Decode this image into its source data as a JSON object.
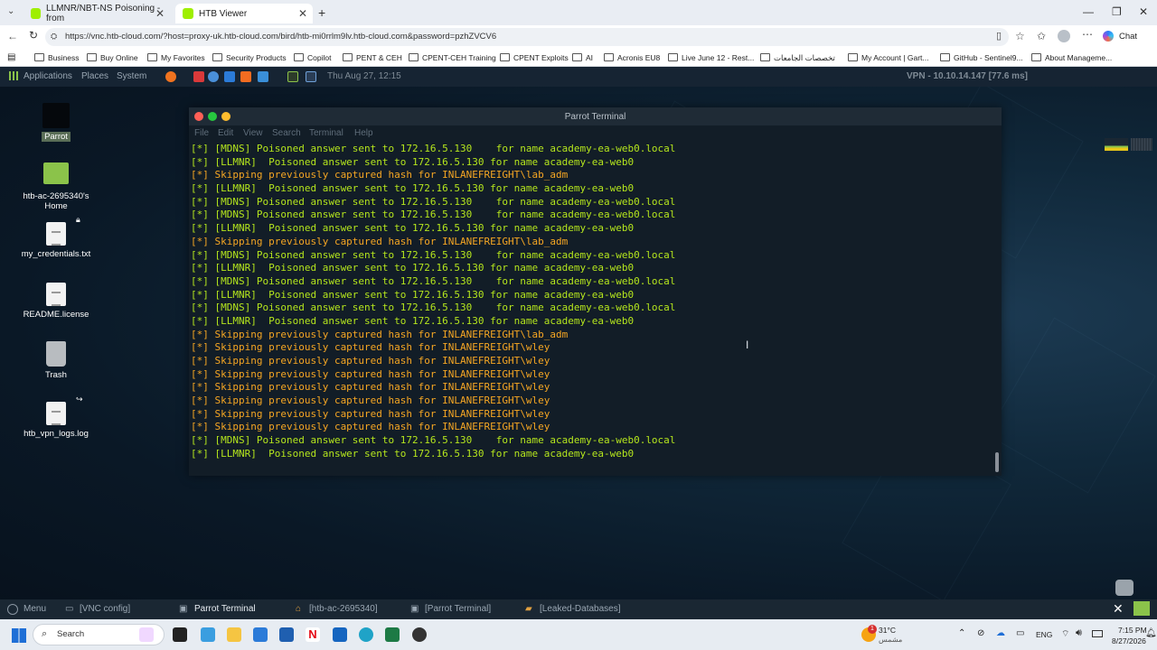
{
  "browser": {
    "tabs": [
      {
        "title": "LLMNR/NBT-NS Poisoning - from"
      },
      {
        "title": "HTB Viewer"
      }
    ],
    "url": "https://vnc.htb-cloud.com/?host=proxy-uk.htb-cloud.com/bird/htb-mi0rrlm9lv.htb-cloud.com&password=pzhZVCV6",
    "chat_label": "Chat",
    "bookmarks": [
      "Business",
      "Buy Online",
      "My Favorites",
      "Security Products",
      "Copilot",
      "PENT & CEH",
      "CPENT-CEH Training",
      "CPENT Exploits",
      "AI",
      "Acronis EU8",
      "Live June 12 - Rest...",
      "تخصصات الجامعات",
      "My Account | Gart...",
      "GitHub - Sentinel9...",
      "About Manageme..."
    ]
  },
  "topbar": {
    "applications": "Applications",
    "places": "Places",
    "system": "System",
    "datetime": "Thu Aug 27, 12:15",
    "vpn": "VPN - 10.10.14.147 [77.6 ms]"
  },
  "desktop_icons": [
    {
      "label": "Parrot"
    },
    {
      "label": "htb-ac-2695340's Home"
    },
    {
      "label": "my_credentials.txt"
    },
    {
      "label": "README.license"
    },
    {
      "label": "Trash"
    },
    {
      "label": "htb_vpn_logs.log"
    }
  ],
  "terminal": {
    "title": "Parrot Terminal",
    "menu": [
      "File",
      "Edit",
      "View",
      "Search",
      "Terminal",
      "Help"
    ],
    "lines": [
      {
        "text": "[*] [MDNS] Poisoned answer sent to 172.16.5.130    for name academy-ea-web0.local",
        "color": "green"
      },
      {
        "text": "[*] [LLMNR]  Poisoned answer sent to 172.16.5.130 for name academy-ea-web0",
        "color": "green"
      },
      {
        "text": "[*] Skipping previously captured hash for INLANEFREIGHT\\lab_adm",
        "color": "orange"
      },
      {
        "text": "[*] [LLMNR]  Poisoned answer sent to 172.16.5.130 for name academy-ea-web0",
        "color": "green"
      },
      {
        "text": "[*] [MDNS] Poisoned answer sent to 172.16.5.130    for name academy-ea-web0.local",
        "color": "green"
      },
      {
        "text": "[*] [MDNS] Poisoned answer sent to 172.16.5.130    for name academy-ea-web0.local",
        "color": "green"
      },
      {
        "text": "[*] [LLMNR]  Poisoned answer sent to 172.16.5.130 for name academy-ea-web0",
        "color": "green"
      },
      {
        "text": "[*] Skipping previously captured hash for INLANEFREIGHT\\lab_adm",
        "color": "orange"
      },
      {
        "text": "[*] [MDNS] Poisoned answer sent to 172.16.5.130    for name academy-ea-web0.local",
        "color": "green"
      },
      {
        "text": "[*] [LLMNR]  Poisoned answer sent to 172.16.5.130 for name academy-ea-web0",
        "color": "green"
      },
      {
        "text": "[*] [MDNS] Poisoned answer sent to 172.16.5.130    for name academy-ea-web0.local",
        "color": "green"
      },
      {
        "text": "[*] [LLMNR]  Poisoned answer sent to 172.16.5.130 for name academy-ea-web0",
        "color": "green"
      },
      {
        "text": "[*] [MDNS] Poisoned answer sent to 172.16.5.130    for name academy-ea-web0.local",
        "color": "green"
      },
      {
        "text": "[*] [LLMNR]  Poisoned answer sent to 172.16.5.130 for name academy-ea-web0",
        "color": "green"
      },
      {
        "text": "[*] Skipping previously captured hash for INLANEFREIGHT\\lab_adm",
        "color": "orange"
      },
      {
        "text": "[*] Skipping previously captured hash for INLANEFREIGHT\\wley",
        "color": "orange"
      },
      {
        "text": "[*] Skipping previously captured hash for INLANEFREIGHT\\wley",
        "color": "orange"
      },
      {
        "text": "[*] Skipping previously captured hash for INLANEFREIGHT\\wley",
        "color": "orange"
      },
      {
        "text": "[*] Skipping previously captured hash for INLANEFREIGHT\\wley",
        "color": "orange"
      },
      {
        "text": "[*] Skipping previously captured hash for INLANEFREIGHT\\wley",
        "color": "orange"
      },
      {
        "text": "[*] Skipping previously captured hash for INLANEFREIGHT\\wley",
        "color": "orange"
      },
      {
        "text": "[*] Skipping previously captured hash for INLANEFREIGHT\\wley",
        "color": "orange"
      },
      {
        "text": "[*] [MDNS] Poisoned answer sent to 172.16.5.130    for name academy-ea-web0.local",
        "color": "green"
      },
      {
        "text": "[*] [LLMNR]  Poisoned answer sent to 172.16.5.130 for name academy-ea-web0",
        "color": "green"
      }
    ]
  },
  "panel": {
    "menu": "Menu",
    "items": [
      "[VNC config]",
      "Parrot Terminal",
      "[htb-ac-2695340]",
      "[Parrot Terminal]",
      "[Leaked-Databases]"
    ]
  },
  "taskbar": {
    "search_placeholder": "Search",
    "weather_temp": "31°C",
    "weather_desc": "مشمس",
    "weather_badge": "1",
    "lang": "ENG",
    "time": "7:15 PM",
    "date": "8/27/2026"
  },
  "colors": {
    "terminal_green": "#b5e61d",
    "terminal_orange": "#f5a623"
  }
}
